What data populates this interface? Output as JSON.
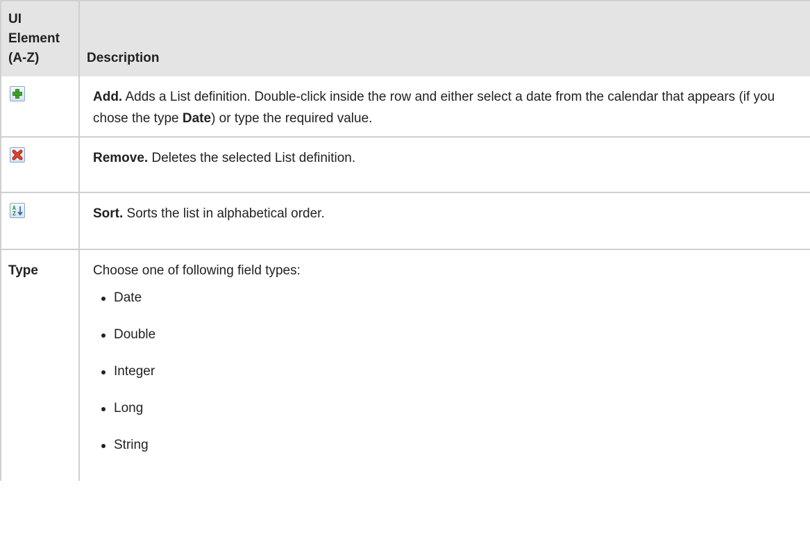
{
  "table": {
    "header": {
      "col1": [
        "UI",
        "Element",
        "(A-Z)"
      ],
      "col2": "Description"
    },
    "rows": {
      "add": {
        "icon": "add-icon",
        "title": "Add.",
        "text_part1": " Adds a List definition. Double-click inside the row and either select a date from the calendar that appears (if you chose the type ",
        "bold_word": "Date",
        "text_part2": ") or type the required value."
      },
      "remove": {
        "icon": "remove-icon",
        "title": "Remove.",
        "text": " Deletes the selected List definition."
      },
      "sort": {
        "icon": "sort-az-icon",
        "title": "Sort.",
        "text": " Sorts the list in alphabetical order."
      },
      "type": {
        "label": "Type",
        "intro": "Choose one of following field types:",
        "options": [
          "Date",
          "Double",
          "Integer",
          "Long",
          "String"
        ]
      }
    }
  },
  "colors": {
    "header_bg": "#e4e4e4",
    "border": "#cfcfcf",
    "add_green": "#3aa32a",
    "remove_red": "#d9331f",
    "sort_green": "#2e8b3a",
    "sort_blue": "#2a5fb0"
  }
}
